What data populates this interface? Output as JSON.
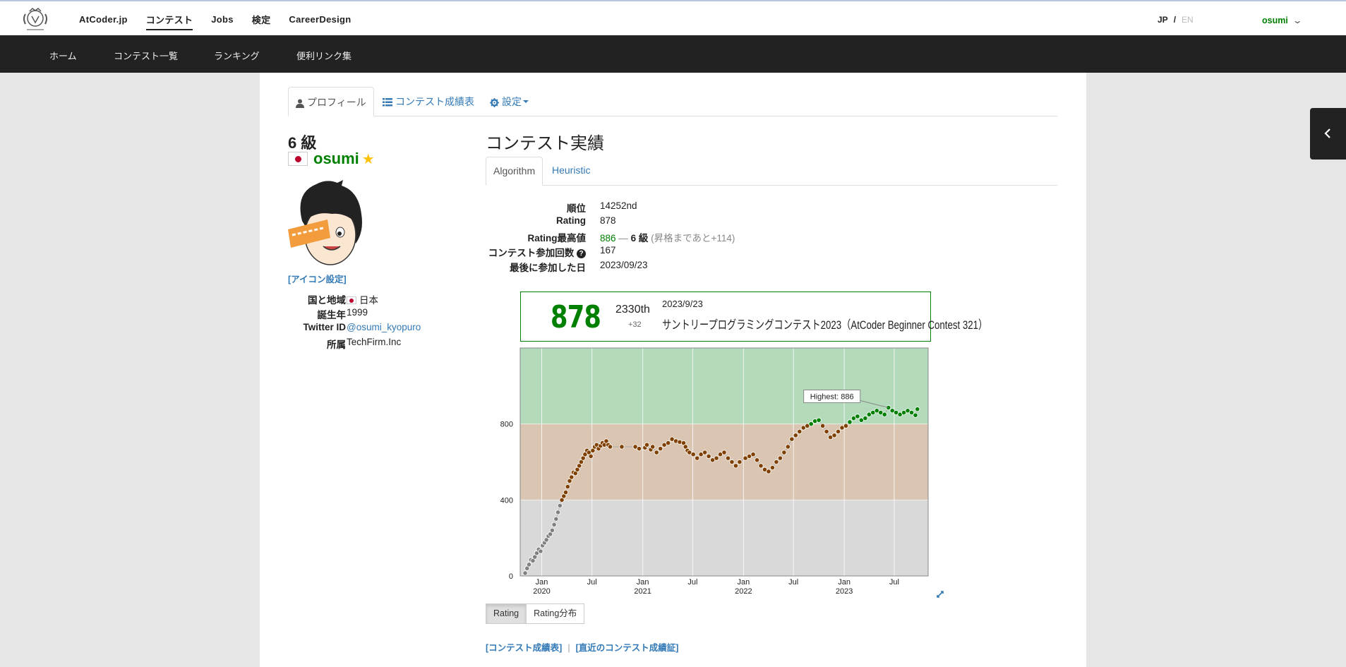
{
  "topbar": {
    "nav": [
      "AtCoder.jp",
      "コンテスト",
      "Jobs",
      "検定",
      "CareerDesign"
    ],
    "active_nav": "コンテスト",
    "lang_jp": "JP",
    "lang_sep": "/",
    "lang_en": "EN",
    "username": "osumi",
    "user_chevron": "⌄"
  },
  "subnav": [
    "ホーム",
    "コンテスト一覧",
    "ランキング",
    "便利リンク集"
  ],
  "tabs": [
    "プロフィール",
    "コンテスト成績表",
    "設定"
  ],
  "profile": {
    "rank": "6 級",
    "username": "osumi",
    "star": "★",
    "icon_setting": "[アイコン設定]",
    "rows": [
      {
        "key": "国と地域",
        "value": "日本"
      },
      {
        "key": "誕生年",
        "value": "1999"
      },
      {
        "key": "Twitter ID",
        "value": "@osumi_kyopuro"
      },
      {
        "key": "所属",
        "value": "TechFirm.Inc"
      }
    ]
  },
  "section": {
    "title": "コンテスト実績",
    "subtabs": [
      "Algorithm",
      "Heuristic"
    ]
  },
  "stats": {
    "rank_label": "順位",
    "rank": "14252nd",
    "rating_label": "Rating",
    "rating": "878",
    "max_label": "Rating最高値",
    "max": "886",
    "max_dash": "—",
    "max_grade": "6 級",
    "max_note": "(昇格まであと+114)",
    "count_label": "コンテスト参加回数",
    "count": "167",
    "last_label": "最後に参加した日",
    "last": "2023/09/23"
  },
  "latest": {
    "rating": "878",
    "place": "2330th",
    "diff": "+32",
    "date": "2023/9/23",
    "contest": "サントリープログラミングコンテスト2023（AtCoder Beginner Contest 321）"
  },
  "chart_data": {
    "type": "line",
    "ylim": [
      0,
      1200
    ],
    "yticks": [
      0,
      400,
      800
    ],
    "xticks": [
      {
        "month": "Jan",
        "year": "2020",
        "date": "2020-01-01"
      },
      {
        "month": "Jul",
        "year": "",
        "date": "2020-07-01"
      },
      {
        "month": "Jan",
        "year": "2021",
        "date": "2021-01-01"
      },
      {
        "month": "Jul",
        "year": "",
        "date": "2021-07-01"
      },
      {
        "month": "Jan",
        "year": "2022",
        "date": "2022-01-01"
      },
      {
        "month": "Jul",
        "year": "",
        "date": "2022-07-01"
      },
      {
        "month": "Jan",
        "year": "2023",
        "date": "2023-01-01"
      },
      {
        "month": "Jul",
        "year": "",
        "date": "2023-07-01"
      }
    ],
    "xlim": [
      "2019-10-15",
      "2023-11-01"
    ],
    "bands": [
      {
        "from": 0,
        "to": 400,
        "color": "#d9d9d9"
      },
      {
        "from": 400,
        "to": 800,
        "color": "#d9c5b2"
      },
      {
        "from": 800,
        "to": 1200,
        "color": "#b2dabb"
      }
    ],
    "highest_label": "Highest: 886",
    "highest": {
      "date": "2023-06-10",
      "value": 886
    },
    "series": [
      {
        "values": [
          [
            "2019-11-02",
            15
          ],
          [
            "2019-11-09",
            40
          ],
          [
            "2019-11-16",
            60
          ],
          [
            "2019-11-23",
            85
          ],
          [
            "2019-11-30",
            80
          ],
          [
            "2019-12-07",
            100
          ],
          [
            "2019-12-14",
            120
          ],
          [
            "2019-12-21",
            140
          ],
          [
            "2019-12-28",
            130
          ],
          [
            "2020-01-04",
            160
          ],
          [
            "2020-01-11",
            175
          ],
          [
            "2020-01-18",
            190
          ],
          [
            "2020-01-25",
            210
          ],
          [
            "2020-02-01",
            220
          ],
          [
            "2020-02-08",
            240
          ],
          [
            "2020-02-15",
            270
          ],
          [
            "2020-02-22",
            300
          ],
          [
            "2020-02-29",
            335
          ],
          [
            "2020-03-07",
            370
          ],
          [
            "2020-03-14",
            400
          ],
          [
            "2020-03-21",
            420
          ],
          [
            "2020-03-28",
            440
          ],
          [
            "2020-04-04",
            470
          ],
          [
            "2020-04-11",
            500
          ],
          [
            "2020-04-18",
            520
          ],
          [
            "2020-04-25",
            545
          ],
          [
            "2020-05-02",
            540
          ],
          [
            "2020-05-09",
            560
          ],
          [
            "2020-05-16",
            580
          ],
          [
            "2020-05-23",
            600
          ],
          [
            "2020-05-30",
            620
          ],
          [
            "2020-06-06",
            640
          ],
          [
            "2020-06-13",
            660
          ],
          [
            "2020-06-20",
            650
          ],
          [
            "2020-06-27",
            630
          ],
          [
            "2020-07-04",
            660
          ],
          [
            "2020-07-11",
            680
          ],
          [
            "2020-07-18",
            690
          ],
          [
            "2020-07-25",
            670
          ],
          [
            "2020-08-01",
            685
          ],
          [
            "2020-08-08",
            700
          ],
          [
            "2020-08-15",
            690
          ],
          [
            "2020-08-22",
            710
          ],
          [
            "2020-08-29",
            690
          ],
          [
            "2020-09-05",
            680
          ],
          [
            "2020-10-17",
            680
          ],
          [
            "2020-12-05",
            680
          ],
          [
            "2020-12-19",
            670
          ],
          [
            "2021-01-09",
            675
          ],
          [
            "2021-01-16",
            690
          ],
          [
            "2021-01-30",
            665
          ],
          [
            "2021-02-06",
            680
          ],
          [
            "2021-02-20",
            650
          ],
          [
            "2021-03-06",
            670
          ],
          [
            "2021-03-20",
            690
          ],
          [
            "2021-04-03",
            700
          ],
          [
            "2021-04-17",
            720
          ],
          [
            "2021-05-01",
            710
          ],
          [
            "2021-05-15",
            705
          ],
          [
            "2021-05-29",
            700
          ],
          [
            "2021-06-05",
            680
          ],
          [
            "2021-06-12",
            660
          ],
          [
            "2021-06-19",
            650
          ],
          [
            "2021-07-03",
            640
          ],
          [
            "2021-07-17",
            620
          ],
          [
            "2021-07-31",
            640
          ],
          [
            "2021-08-14",
            650
          ],
          [
            "2021-08-28",
            630
          ],
          [
            "2021-09-11",
            610
          ],
          [
            "2021-09-25",
            620
          ],
          [
            "2021-10-09",
            640
          ],
          [
            "2021-10-23",
            650
          ],
          [
            "2021-11-06",
            620
          ],
          [
            "2021-11-20",
            600
          ],
          [
            "2021-12-04",
            580
          ],
          [
            "2021-12-18",
            600
          ],
          [
            "2022-01-08",
            620
          ],
          [
            "2022-01-22",
            630
          ],
          [
            "2022-02-05",
            640
          ],
          [
            "2022-02-19",
            610
          ],
          [
            "2022-03-05",
            580
          ],
          [
            "2022-03-19",
            560
          ],
          [
            "2022-04-02",
            550
          ],
          [
            "2022-04-16",
            570
          ],
          [
            "2022-04-30",
            600
          ],
          [
            "2022-05-14",
            620
          ],
          [
            "2022-05-28",
            650
          ],
          [
            "2022-06-11",
            680
          ],
          [
            "2022-06-25",
            720
          ],
          [
            "2022-07-09",
            740
          ],
          [
            "2022-07-23",
            760
          ],
          [
            "2022-08-06",
            780
          ],
          [
            "2022-08-20",
            790
          ],
          [
            "2022-09-03",
            800
          ],
          [
            "2022-09-17",
            815
          ],
          [
            "2022-10-01",
            820
          ],
          [
            "2022-10-15",
            790
          ],
          [
            "2022-10-29",
            760
          ],
          [
            "2022-11-12",
            730
          ],
          [
            "2022-11-26",
            740
          ],
          [
            "2022-12-10",
            760
          ],
          [
            "2022-12-24",
            780
          ],
          [
            "2023-01-07",
            790
          ],
          [
            "2023-01-21",
            810
          ],
          [
            "2023-02-04",
            830
          ],
          [
            "2023-02-18",
            840
          ],
          [
            "2023-03-04",
            820
          ],
          [
            "2023-03-18",
            830
          ],
          [
            "2023-04-01",
            850
          ],
          [
            "2023-04-15",
            860
          ],
          [
            "2023-04-29",
            870
          ],
          [
            "2023-05-13",
            860
          ],
          [
            "2023-05-27",
            850
          ],
          [
            "2023-06-10",
            886
          ],
          [
            "2023-06-24",
            870
          ],
          [
            "2023-07-08",
            860
          ],
          [
            "2023-07-22",
            850
          ],
          [
            "2023-08-05",
            860
          ],
          [
            "2023-08-19",
            870
          ],
          [
            "2023-09-02",
            860
          ],
          [
            "2023-09-16",
            846
          ],
          [
            "2023-09-23",
            878
          ]
        ]
      }
    ]
  },
  "chart_buttons": [
    "Rating",
    "Rating分布"
  ],
  "links": [
    "[コンテスト成績表]",
    "[直近のコンテスト成績証]"
  ],
  "colors": {
    "green": "#008000",
    "brown": "#804000",
    "gray": "#808080",
    "link": "#337ab7"
  }
}
